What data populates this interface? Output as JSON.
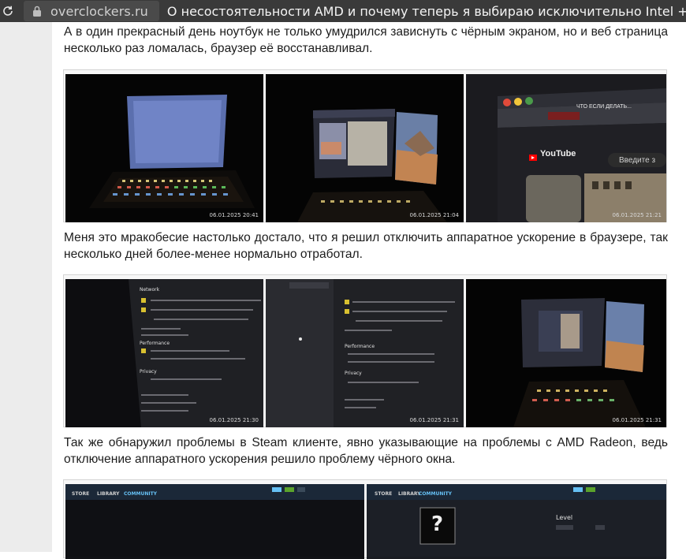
{
  "browser": {
    "domain": "overclockers.ru",
    "page_title": "О несостоятельности AMD и почему теперь я выбираю исключительно Intel + NVIDIA дл",
    "icons": {
      "reload": "reload-icon",
      "lock": "lock-icon"
    }
  },
  "article": {
    "paragraph_1": "А в один прекрасный день ноутбук не только умудрился зависнуть с чёрным экраном, но и веб страница несколько раз ломалась, браузер её восстанавливал.",
    "paragraph_2": "Меня это мракобесие настолько достало, что я решил отключить аппаратное ускорение в браузере, так несколько дней более-менее нормально отработал.",
    "paragraph_3": "Так же обнаружил проблемы в Steam клиенте, явно указывающие на проблемы с AMD Radeon, ведь отключение аппаратного ускорения решило проблему чёрного окна."
  },
  "gallery_1": {
    "photos": [
      {
        "timestamp": "06.01.2025 20:41"
      },
      {
        "timestamp": "06.01.2025 21:04"
      },
      {
        "timestamp": "06.01.2025 21:21",
        "youtube_label": "YouTube",
        "search_hint": "Введите з",
        "tab_title": "ЧТО ЕСЛИ ДЕЛАТЬ..."
      }
    ]
  },
  "gallery_2": {
    "photos": [
      {
        "timestamp": "06.01.2025 21:30",
        "section_network": "Network",
        "section_performance": "Performance",
        "section_privacy": "Privacy"
      },
      {
        "timestamp": "06.01.2025 21:31",
        "section_performance": "Performance",
        "section_privacy": "Privacy"
      },
      {
        "timestamp": "06.01.2025 21:31"
      }
    ]
  },
  "gallery_3": {
    "photos": [
      {
        "nav": [
          "STORE",
          "LIBRARY",
          "COMMUNITY"
        ]
      },
      {
        "nav": [
          "STORE",
          "LIBRARY",
          "COMMUNITY"
        ],
        "level_label": "Level",
        "unknown_glyph": "?"
      }
    ]
  },
  "colors": {
    "browser_bar": "#3a3a3a",
    "page_margin": "#ececec",
    "text": "#1c1c1c",
    "steam_accent": "#66c0f4"
  }
}
